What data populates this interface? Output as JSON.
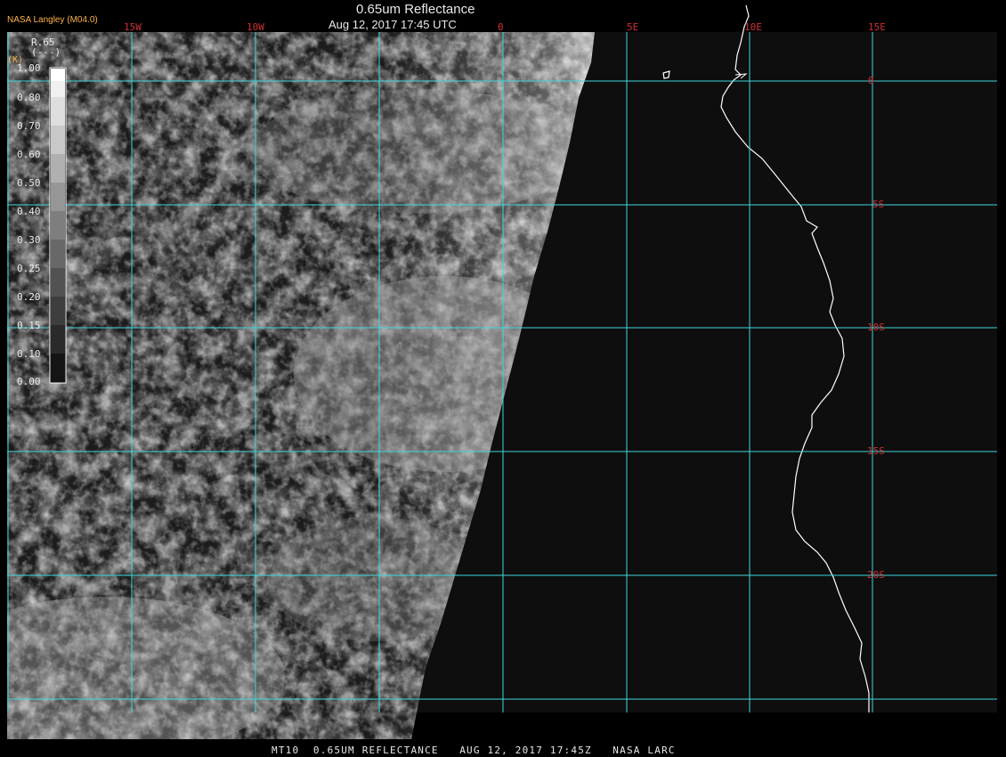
{
  "header": {
    "title": "0.65um Reflectance",
    "datetime": "Aug 12, 2017 17:45 UTC",
    "credit": "NASA Langley (M04.0)"
  },
  "footer": {
    "text": "MT10  0.65UM REFLECTANCE   AUG 12, 2017 17:45Z   NASA LARC"
  },
  "grid": {
    "lon_labels": [
      "15W",
      "10W",
      "0",
      "5E",
      "10E",
      "15E"
    ],
    "lat_labels": [
      "0",
      "5S",
      "10S",
      "15S",
      "20S"
    ],
    "line_color": "#3fd6dc",
    "label_color": "#d23030"
  },
  "colorbar": {
    "title_line1": "R.65",
    "title_line2": "(---)",
    "unit": "(K)",
    "ticks": [
      "1.00",
      "0.80",
      "0.70",
      "0.60",
      "0.50",
      "0.40",
      "0.30",
      "0.25",
      "0.20",
      "0.15",
      "0.10",
      "0.00"
    ]
  },
  "colors": {
    "background": "#000000",
    "ocean": "#0e0e0e",
    "coastline": "#ffffff"
  }
}
